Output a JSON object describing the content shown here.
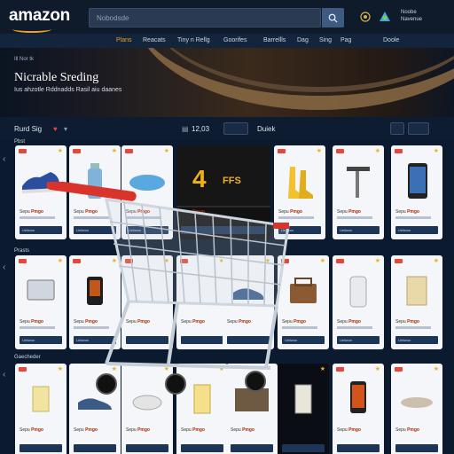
{
  "header": {
    "logo": "amazon",
    "search_placeholder": "Nobodsde",
    "account_text": "Noobe\nNavenue"
  },
  "nav": {
    "items": [
      "Plans",
      "Reacats",
      "Tiny n Rellg",
      "Goorifes",
      "Barrellls",
      "Dag",
      "Sing",
      "Pag",
      "Doole"
    ],
    "active_index": 0
  },
  "hero": {
    "kicker": "Ill Nor tk",
    "title": "Nicrable Sreding",
    "subtitle": "Ius ahzotle Rddnadds Rasil aiu daanes"
  },
  "toolbar": {
    "section_title": "Rurd Sig",
    "count": "12,03",
    "sort_label": "Duiek"
  },
  "sections": [
    {
      "label": "Pbst"
    },
    {
      "label": "Prasts"
    },
    {
      "label": "Gaecheder"
    }
  ],
  "promo": {
    "big": "4",
    "small": "FFS"
  },
  "card_text": {
    "price_prefix": "Sepu",
    "price_value": "Pmgo",
    "cta": "Ueiiwon"
  },
  "colors": {
    "accent": "#f0a01a",
    "page_bg": "#0b1a2e",
    "header_bg": "#0f1b2b",
    "price_red": "#b12704"
  }
}
